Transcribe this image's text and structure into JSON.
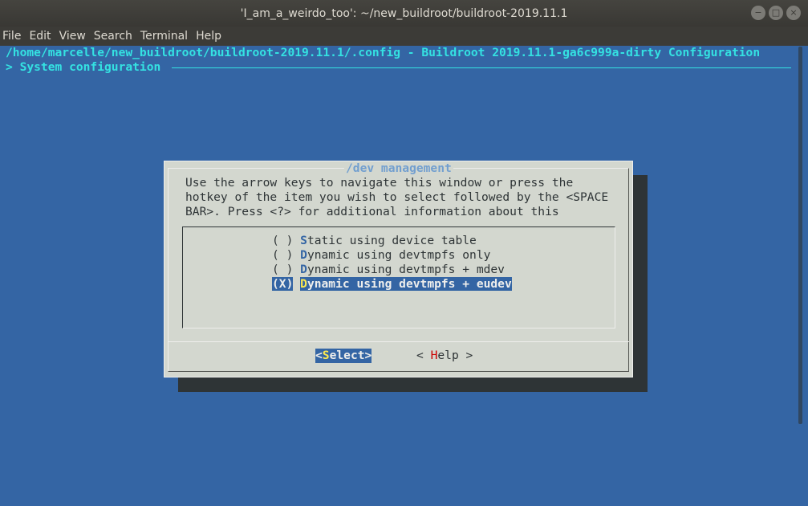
{
  "window": {
    "title": "'I_am_a_weirdo_too': ~/new_buildroot/buildroot-2019.11.1",
    "buttons": [
      "−",
      "□",
      "×"
    ]
  },
  "menubar": [
    "File",
    "Edit",
    "View",
    "Search",
    "Terminal",
    "Help"
  ],
  "terminal": {
    "header_line": "/home/marcelle/new_buildroot/buildroot-2019.11.1/.config - Buildroot 2019.11.1-ga6c999a-dirty Configuration",
    "breadcrumb": "> System configuration"
  },
  "dialog": {
    "title": "/dev management",
    "help_lines": [
      "Use the arrow keys to navigate this window or press the",
      "hotkey of the item you wish to select followed by the <SPACE",
      "BAR>. Press <?> for additional information about this"
    ],
    "options": [
      {
        "box": "( )",
        "hotkey": "S",
        "rest": "tatic using device table",
        "selected": false
      },
      {
        "box": "( )",
        "hotkey": "D",
        "rest": "ynamic using devtmpfs only",
        "selected": false
      },
      {
        "box": "( )",
        "hotkey": "D",
        "rest": "ynamic using devtmpfs + mdev",
        "selected": false
      },
      {
        "box": "(X)",
        "hotkey": "D",
        "rest": "ynamic using devtmpfs + eudev",
        "selected": true
      }
    ],
    "buttons": {
      "select": {
        "pre": "<",
        "hotkey": "S",
        "post": "elect>"
      },
      "help": {
        "pre": "< ",
        "hotkey": "H",
        "post": "elp >"
      }
    }
  },
  "colors": {
    "terminal_bg": "#3465a4",
    "dialog_bg": "#d3d7cf",
    "accent_cyan": "#34e2e2",
    "hotkey_red": "#cc0000",
    "hotkey_yellow": "#fce94f"
  }
}
